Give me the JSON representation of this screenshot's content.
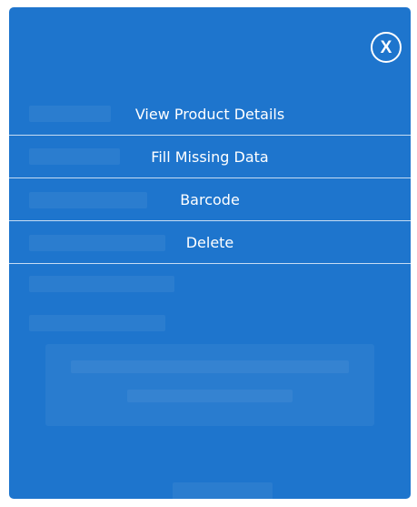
{
  "close_button": {
    "label": "X"
  },
  "menu": {
    "items": [
      {
        "label": "View Product Details"
      },
      {
        "label": "Fill Missing Data"
      },
      {
        "label": "Barcode"
      },
      {
        "label": "Delete"
      }
    ]
  },
  "colors": {
    "panel_background": "#1e75cd",
    "text": "#ffffff"
  }
}
